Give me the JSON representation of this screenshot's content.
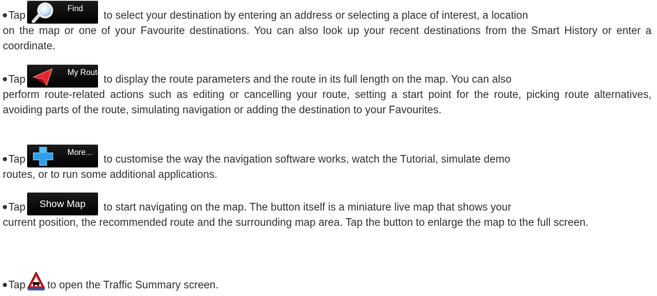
{
  "items": [
    {
      "tap": "Tap",
      "button_label": "Find",
      "button_icon": "magnifier-icon",
      "text_first": "to select your destination by entering an address or selecting a place of interest, a location",
      "text_rest": "on the map or one of your Favourite destinations. You can also look up your recent destinations from the Smart History or enter a coordinate."
    },
    {
      "tap": "Tap",
      "button_label": "My Route",
      "button_icon": "route-arrow-icon",
      "text_first": "to display the route parameters and the route in its full length on the map. You can also",
      "text_rest": "perform route-related actions such as editing or cancelling your route, setting a start point for the route, picking route alternatives, avoiding parts of the route, simulating navigation or adding the destination to your Favourites."
    },
    {
      "tap": "Tap",
      "button_label": "More...",
      "button_icon": "plus-icon",
      "text_first": "to customise the way the navigation software works, watch the Tutorial, simulate demo",
      "text_rest": "routes, or to run some additional applications."
    },
    {
      "tap": "Tap",
      "button_label": "Show Map",
      "text_first": "to start navigating on the map. The button itself is a miniature live map that shows your",
      "text_rest": "current position, the recommended route and the surrounding map area. Tap the button to enlarge the map to the full screen."
    },
    {
      "tap": "Tap",
      "button_icon": "traffic-warning-icon",
      "text_first": "to open the Traffic Summary screen.",
      "text_rest": ""
    }
  ],
  "colors": {
    "text": "#333333",
    "button_bg": "#000000",
    "button_text": "#ffffff",
    "accent_red": "#e0262a",
    "accent_blue": "#2aa0e8"
  }
}
